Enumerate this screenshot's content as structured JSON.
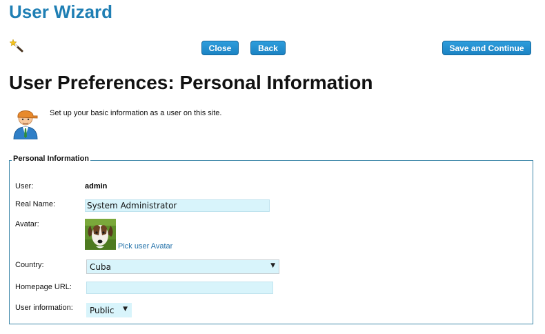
{
  "header": {
    "wizard_title": "User Wizard",
    "close_label": "Close",
    "back_label": "Back",
    "save_continue_label": "Save and Continue",
    "wand_icon": "magic-wand-icon"
  },
  "page": {
    "heading": "User Preferences: Personal Information",
    "intro_text": "Set up your basic information as a user on this site.",
    "user_icon": "user-avatar-icon"
  },
  "personal_info": {
    "legend": "Personal Information",
    "user_label": "User:",
    "user_value": "admin",
    "real_name_label": "Real Name:",
    "real_name_value": "System Administrator",
    "avatar_label": "Avatar:",
    "pick_avatar_link": "Pick user Avatar",
    "country_label": "Country:",
    "country_value": "Cuba",
    "homepage_label": "Homepage URL:",
    "homepage_value": "",
    "user_information_label": "User information:",
    "user_information_value": "Public"
  },
  "colors": {
    "accent": "#1f7fb4",
    "button": "#1c83c3",
    "input_bg": "#d8f4fb",
    "fieldset_border": "#3c86a8"
  }
}
